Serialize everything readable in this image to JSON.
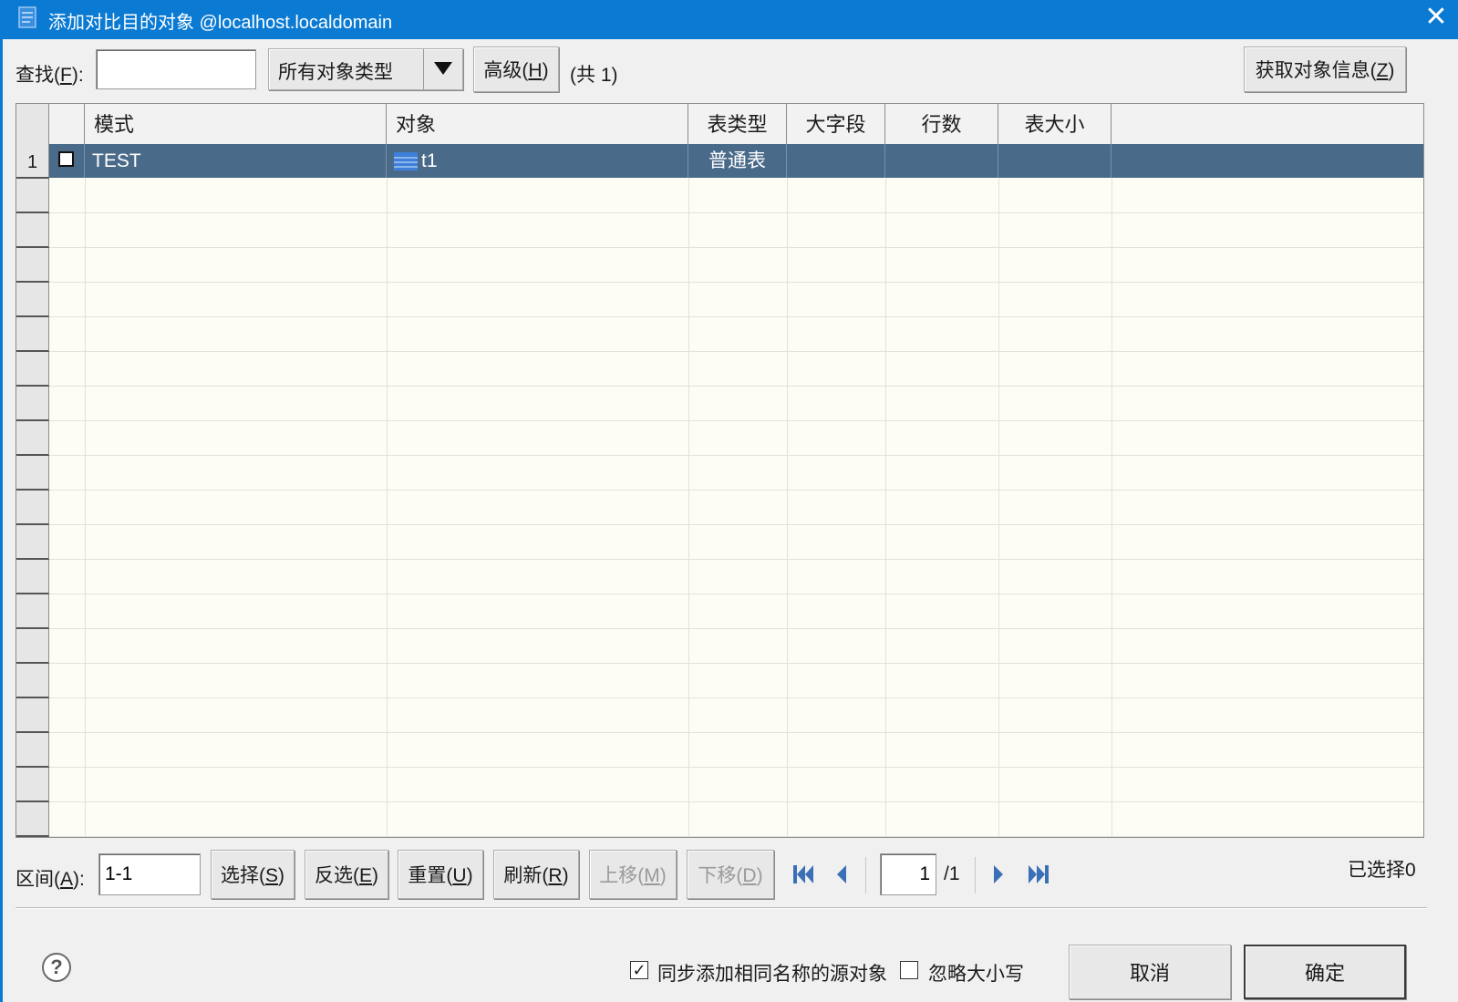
{
  "window": {
    "title": "添加对比目的对象 @localhost.localdomain",
    "close_label": "✕"
  },
  "toolbar": {
    "search_label_prefix": "查找(",
    "search_label_key": "F",
    "search_label_suffix": "):",
    "search_value": "",
    "type_select_value": "所有对象类型",
    "advanced_prefix": "高级(",
    "advanced_key": "H",
    "advanced_suffix": ")",
    "count_text": "(共 1)",
    "fetch_prefix": "获取对象信息(",
    "fetch_key": "Z",
    "fetch_suffix": ")"
  },
  "table": {
    "columns": [
      "模式",
      "对象",
      "表类型",
      "大字段",
      "行数",
      "表大小"
    ],
    "rows": [
      {
        "index": "1",
        "checked": false,
        "schema": "TEST",
        "object": "t1",
        "table_type": "普通表",
        "lob": "",
        "row_count": "",
        "table_size": ""
      }
    ]
  },
  "footer": {
    "range_prefix": "区间(",
    "range_key": "A",
    "range_suffix": "):",
    "range_value": "1-1",
    "select_btn": [
      "选择(",
      "S",
      ")"
    ],
    "invert_btn": [
      "反选(",
      "E",
      ")"
    ],
    "reset_btn": [
      "重置(",
      "U",
      ")"
    ],
    "refresh_btn": [
      "刷新(",
      "R",
      ")"
    ],
    "move_up_btn": [
      "上移(",
      "M",
      ")"
    ],
    "move_down_btn": [
      "下移(",
      "D",
      ")"
    ],
    "page_value": "1",
    "page_total": "/1",
    "selected_text": "已选择0",
    "sync_checked": true,
    "sync_label": "同步添加相同名称的源对象",
    "ignore_case_checked": false,
    "ignore_case_label": "忽略大小写",
    "cancel_label": "取消",
    "ok_label": "确定"
  },
  "colors": {
    "titlebar": "#0a7ad3",
    "selected_row": "#4a6a8a",
    "nav_icon": "#3b6fb6"
  },
  "icons": {
    "app": "document-icon",
    "table": "table-icon",
    "help": "help-icon",
    "nav": [
      "first-page-icon",
      "prev-page-icon",
      "next-page-icon",
      "last-page-icon"
    ]
  }
}
